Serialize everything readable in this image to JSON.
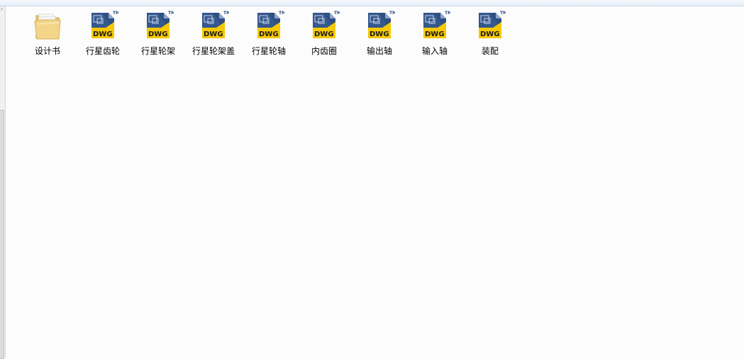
{
  "files": [
    {
      "name": "设计书",
      "type": "folder",
      "icon": "folder-icon"
    },
    {
      "name": "行星齿轮",
      "type": "dwg",
      "icon": "dwg-file-icon",
      "badge": "DWG",
      "trademark": "TM"
    },
    {
      "name": "行星轮架",
      "type": "dwg",
      "icon": "dwg-file-icon",
      "badge": "DWG",
      "trademark": "TM"
    },
    {
      "name": "行星轮架盖",
      "type": "dwg",
      "icon": "dwg-file-icon",
      "badge": "DWG",
      "trademark": "TM"
    },
    {
      "name": "行星轮轴",
      "type": "dwg",
      "icon": "dwg-file-icon",
      "badge": "DWG",
      "trademark": "TM"
    },
    {
      "name": "内齿圈",
      "type": "dwg",
      "icon": "dwg-file-icon",
      "badge": "DWG",
      "trademark": "TM"
    },
    {
      "name": "输出轴",
      "type": "dwg",
      "icon": "dwg-file-icon",
      "badge": "DWG",
      "trademark": "TM"
    },
    {
      "name": "输入轴",
      "type": "dwg",
      "icon": "dwg-file-icon",
      "badge": "DWG",
      "trademark": "TM"
    },
    {
      "name": "装配",
      "type": "dwg",
      "icon": "dwg-file-icon",
      "badge": "DWG",
      "trademark": "TM"
    }
  ],
  "colors": {
    "dwg_blue": "#2e4f82",
    "dwg_yellow": "#f5c800",
    "folder_yellow": "#f2d589",
    "background": "#fcfcfc"
  }
}
